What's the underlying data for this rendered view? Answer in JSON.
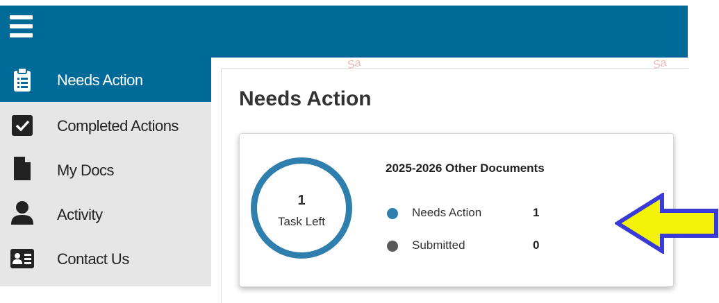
{
  "header": {
    "menu_icon": "hamburger-menu-icon",
    "brand_color": "#006b99"
  },
  "sidebar": {
    "items": [
      {
        "label": "Needs Action",
        "icon": "clipboard-icon",
        "active": true
      },
      {
        "label": "Completed Actions",
        "icon": "checkbox-icon",
        "active": false
      },
      {
        "label": "My Docs",
        "icon": "document-icon",
        "active": false
      },
      {
        "label": "Activity",
        "icon": "person-icon",
        "active": false
      },
      {
        "label": "Contact Us",
        "icon": "contact-card-icon",
        "active": false
      }
    ]
  },
  "main": {
    "title": "Needs Action",
    "card": {
      "task_count": "1",
      "task_label": "Task Left",
      "title": "2025-2026 Other Documents",
      "legend": [
        {
          "label": "Needs Action",
          "count": "1",
          "color": "#2e7fad"
        },
        {
          "label": "Submitted",
          "count": "0",
          "color": "#595959"
        }
      ]
    }
  },
  "annotation": {
    "arrow_fill": "#f5f20a",
    "arrow_stroke": "#3a3ad6"
  }
}
